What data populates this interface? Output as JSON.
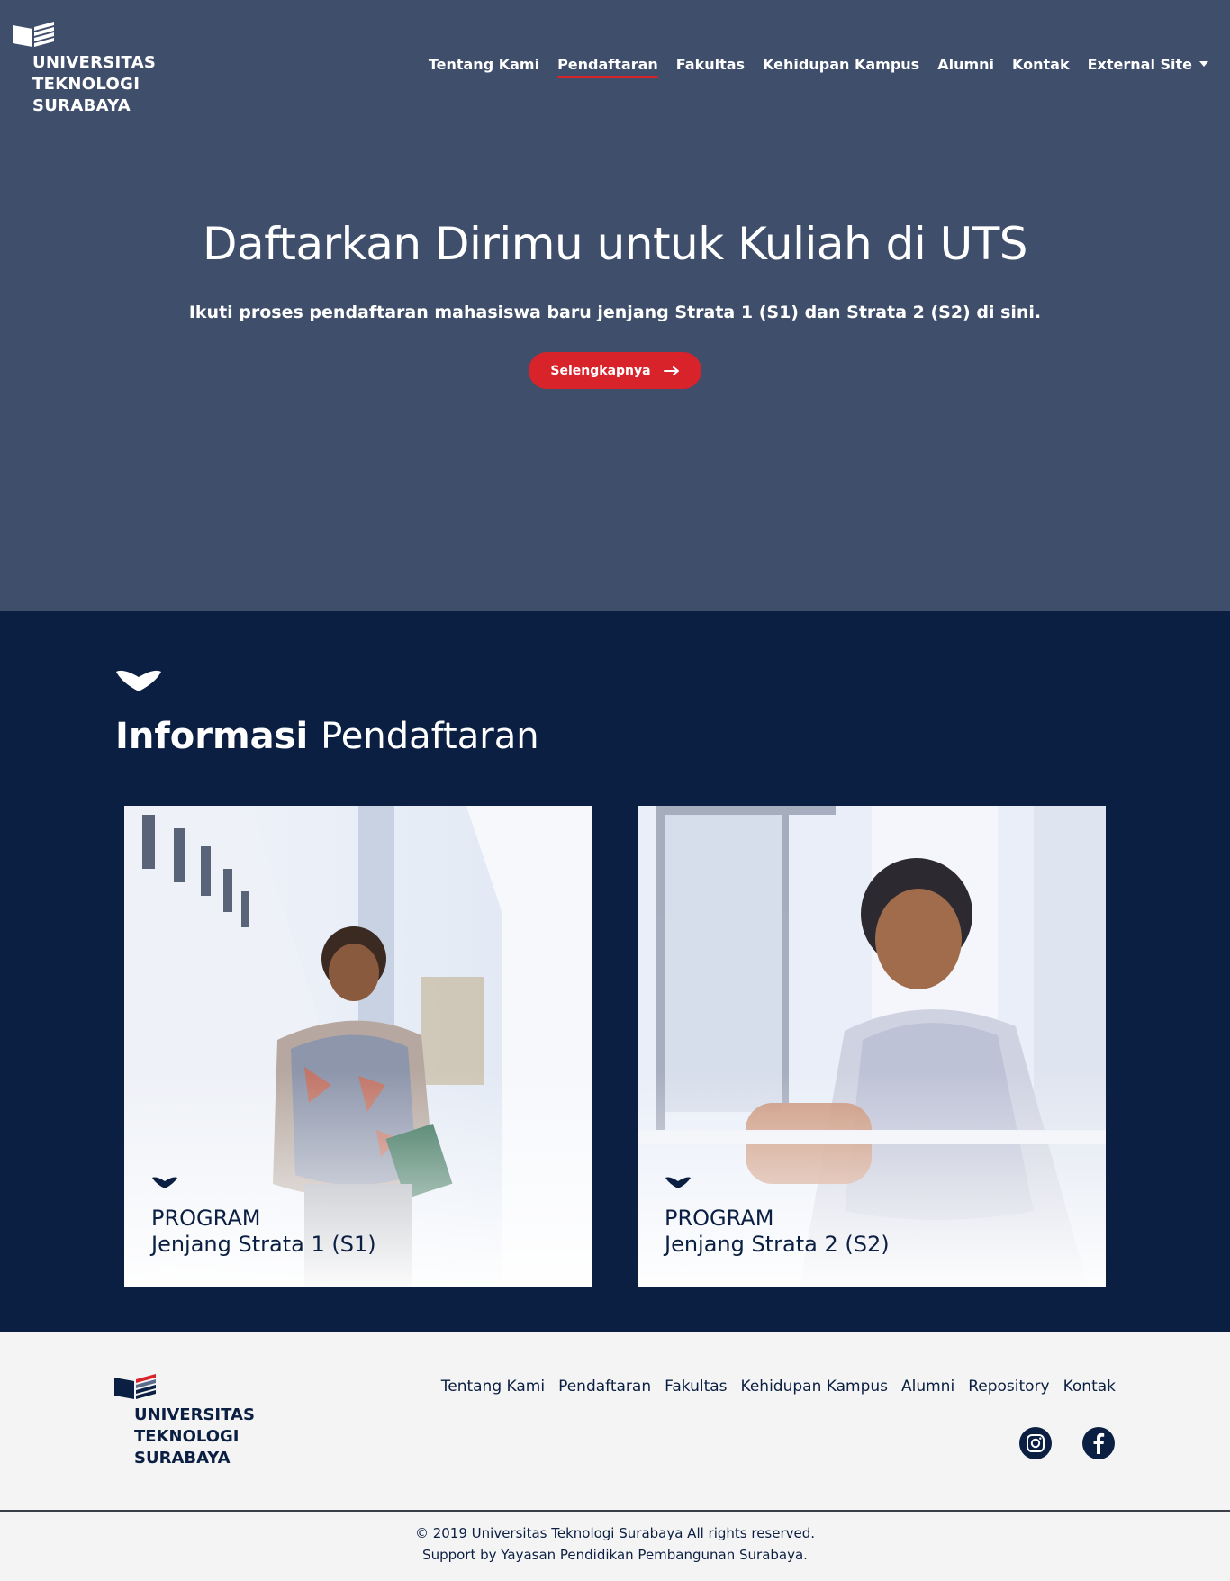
{
  "header": {
    "logo_lines": [
      "UNIVERSITAS",
      "TEKNOLOGI",
      "SURABAYA"
    ],
    "nav": [
      "Tentang Kami",
      "Pendaftaran",
      "Fakultas",
      "Kehidupan Kampus",
      "Alumni",
      "Kontak",
      "External Site"
    ],
    "active_nav": "Pendaftaran"
  },
  "hero": {
    "title": "Daftarkan Dirimu untuk Kuliah di UTS",
    "subtitle": "Ikuti proses pendaftaran mahasiswa baru jenjang Strata 1 (S1) dan Strata 2 (S2) di sini.",
    "button_label": "Selengkapnya",
    "button_icon": "arrow-right-icon"
  },
  "info": {
    "title_bold": "Informasi",
    "title_light": "Pendaftaran",
    "cards": [
      {
        "label_top": "PROGRAM",
        "label_bottom": "Jenjang Strata 1 (S1)"
      },
      {
        "label_top": "PROGRAM",
        "label_bottom": "Jenjang Strata 2 (S2)"
      }
    ]
  },
  "footer": {
    "logo_lines": [
      "UNIVERSITAS",
      "TEKNOLOGI",
      "SURABAYA"
    ],
    "nav": [
      "Tentang Kami",
      "Pendaftaran",
      "Fakultas",
      "Kehidupan Kampus",
      "Alumni",
      "Repository",
      "Kontak"
    ],
    "social": [
      "instagram-icon",
      "facebook-icon"
    ],
    "copyright": "© 2019 Universitas Teknologi Surabaya All rights reserved.",
    "support": "Support by Yayasan Pendidikan Pembangunan Surabaya."
  },
  "colors": {
    "hero_bg": "#3f4e6a",
    "navy": "#0b1f42",
    "accent_red": "#d8232a",
    "footer_bg": "#f4f4f4"
  }
}
